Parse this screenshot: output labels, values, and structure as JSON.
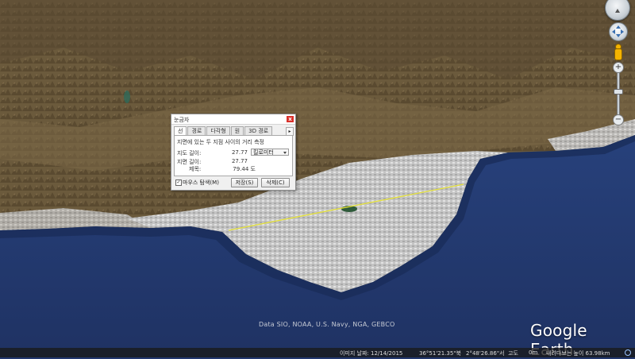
{
  "map": {
    "attribution": "Data SIO, NOAA, U.S. Navy, NGA, GEBCO",
    "logo": "Google Earth",
    "colors": {
      "sea": "#23386e",
      "land": "#6a5a3d",
      "greenhouse": "#c9c9c9",
      "ruler_line": "#e6e23a"
    }
  },
  "nav": {
    "compass_icon": "compass-icon",
    "look_icon": "look-joystick-icon",
    "pegman_icon": "street-view-pegman-icon",
    "zoom_in": "+",
    "zoom_out": "−"
  },
  "ruler": {
    "title": "눈금자",
    "close": "x",
    "tabs": [
      "선",
      "경로",
      "다각형",
      "원",
      "3D 경로"
    ],
    "tab_next": "▸",
    "description": "지면에 있는 두 지점 사이의 거리 측정",
    "map_length_label": "지도 길이:",
    "map_length_value": "27.77",
    "unit": "킬로미터",
    "ground_length_label": "지면 길이:",
    "ground_length_value": "27.77",
    "heading_label": "제목:",
    "heading_value": "79.44 도",
    "mouse_nav_checked": "✓",
    "mouse_nav_label": "마우스 탐색(M)",
    "save_label": "저장(S)",
    "clear_label": "삭제(C)"
  },
  "status": {
    "image_date": "이미지 날짜: 12/14/2015",
    "lat": "36°51'21.35\"북",
    "lon": "2°48'26.86\"서",
    "elev_label": "고도",
    "elev_value": "0m",
    "eye_alt": "내려다보는 높이 63.98km"
  }
}
